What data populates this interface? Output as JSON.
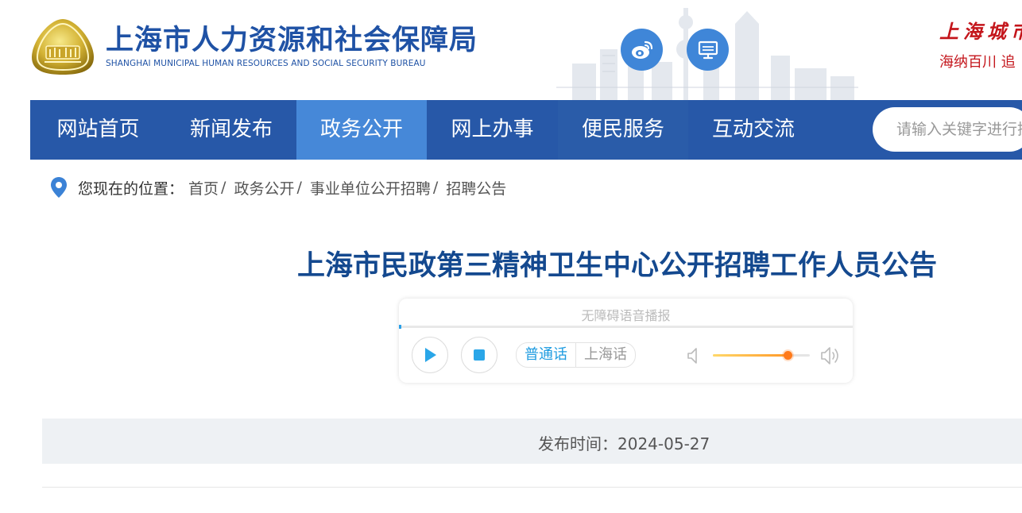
{
  "header": {
    "title": "上海市人力资源和社会保障局",
    "subtitle": "SHANGHAI MUNICIPAL HUMAN RESOURCES AND SOCIAL SECURITY BUREAU",
    "slogan_line1": "上海城市",
    "slogan_line2": "海纳百川  追",
    "icons": [
      "weibo-icon",
      "desktop-icon"
    ]
  },
  "nav": {
    "items": [
      {
        "label": "网站首页"
      },
      {
        "label": "新闻发布"
      },
      {
        "label": "政务公开"
      },
      {
        "label": "网上办事"
      },
      {
        "label": "便民服务"
      },
      {
        "label": "互动交流"
      }
    ],
    "active_index": 2,
    "search_placeholder": "请输入关键字进行搜索"
  },
  "breadcrumb": {
    "prefix": "您现在的位置：",
    "items": [
      "首页",
      "政务公开",
      "事业单位公开招聘",
      "招聘公告"
    ],
    "separator": "/"
  },
  "article": {
    "title": "上海市民政第三精神卫生中心公开招聘工作人员公告",
    "publish_label": "发布时间：",
    "publish_date": "2024-05-27"
  },
  "audio_player": {
    "title": "无障碍语音播报",
    "dialects": [
      "普通话",
      "上海话"
    ],
    "selected_dialect": "普通话",
    "volume_fraction": 0.77,
    "progress_fraction": 0.0
  },
  "colors": {
    "nav_bg": "#2758a8",
    "nav_active": "#4688d8",
    "title_blue": "#14498f",
    "slogan_red": "#c4161c"
  }
}
